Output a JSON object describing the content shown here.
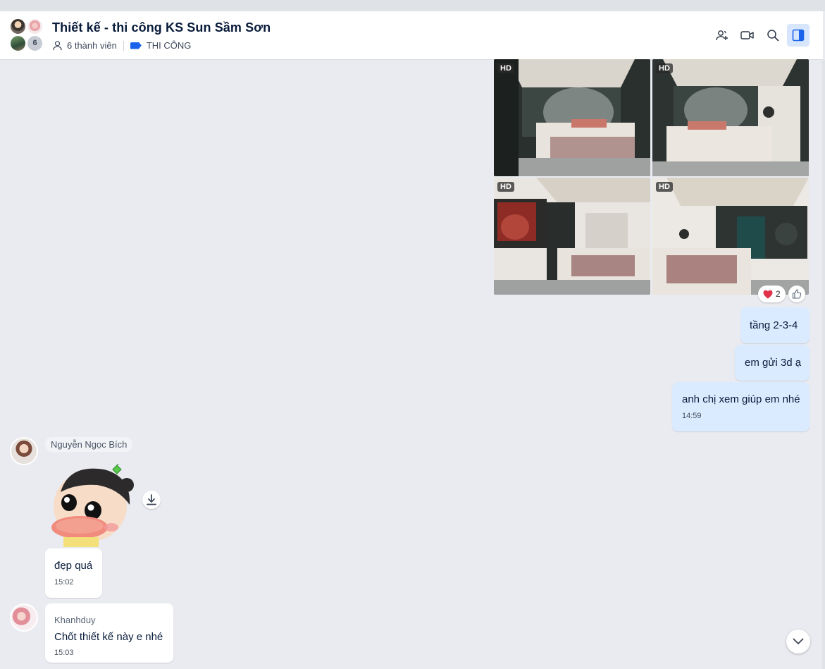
{
  "header": {
    "group_title": "Thiết kế - thi công KS Sun Sầm Sơn",
    "member_count_label": "6 thành viên",
    "avatar_overflow": "6",
    "label_tag": "THI CÔNG",
    "label_tag_color": "#1b63ea",
    "icons": [
      "add-member-icon",
      "video-call-icon",
      "search-icon",
      "sidebar-toggle-icon"
    ]
  },
  "image_album": {
    "badge": "HD",
    "reactions": {
      "heart_count": "2"
    }
  },
  "messages": [
    {
      "from": "me",
      "text": "tầng 2-3-4"
    },
    {
      "from": "me",
      "text": "em gửi 3d ạ"
    },
    {
      "from": "me",
      "text": "anh chị xem giúp em nhé",
      "time": "14:59"
    },
    {
      "from": "Nguyễn Ngọc Bích",
      "sender_label": "Nguyễn Ngọc Bích",
      "type": "sticker"
    },
    {
      "from": "Nguyễn Ngọc Bích",
      "text": "đẹp quá",
      "time": "15:02"
    },
    {
      "from": "Khanhduy",
      "sender_label": "Khanhduy",
      "text": "Chốt thiết kế này e nhé",
      "time": "15:03"
    }
  ],
  "colors": {
    "my_bubble": "#dbebff",
    "their_bubble": "#ffffff",
    "background": "#e9ebf0",
    "accent": "#1b63ea"
  }
}
